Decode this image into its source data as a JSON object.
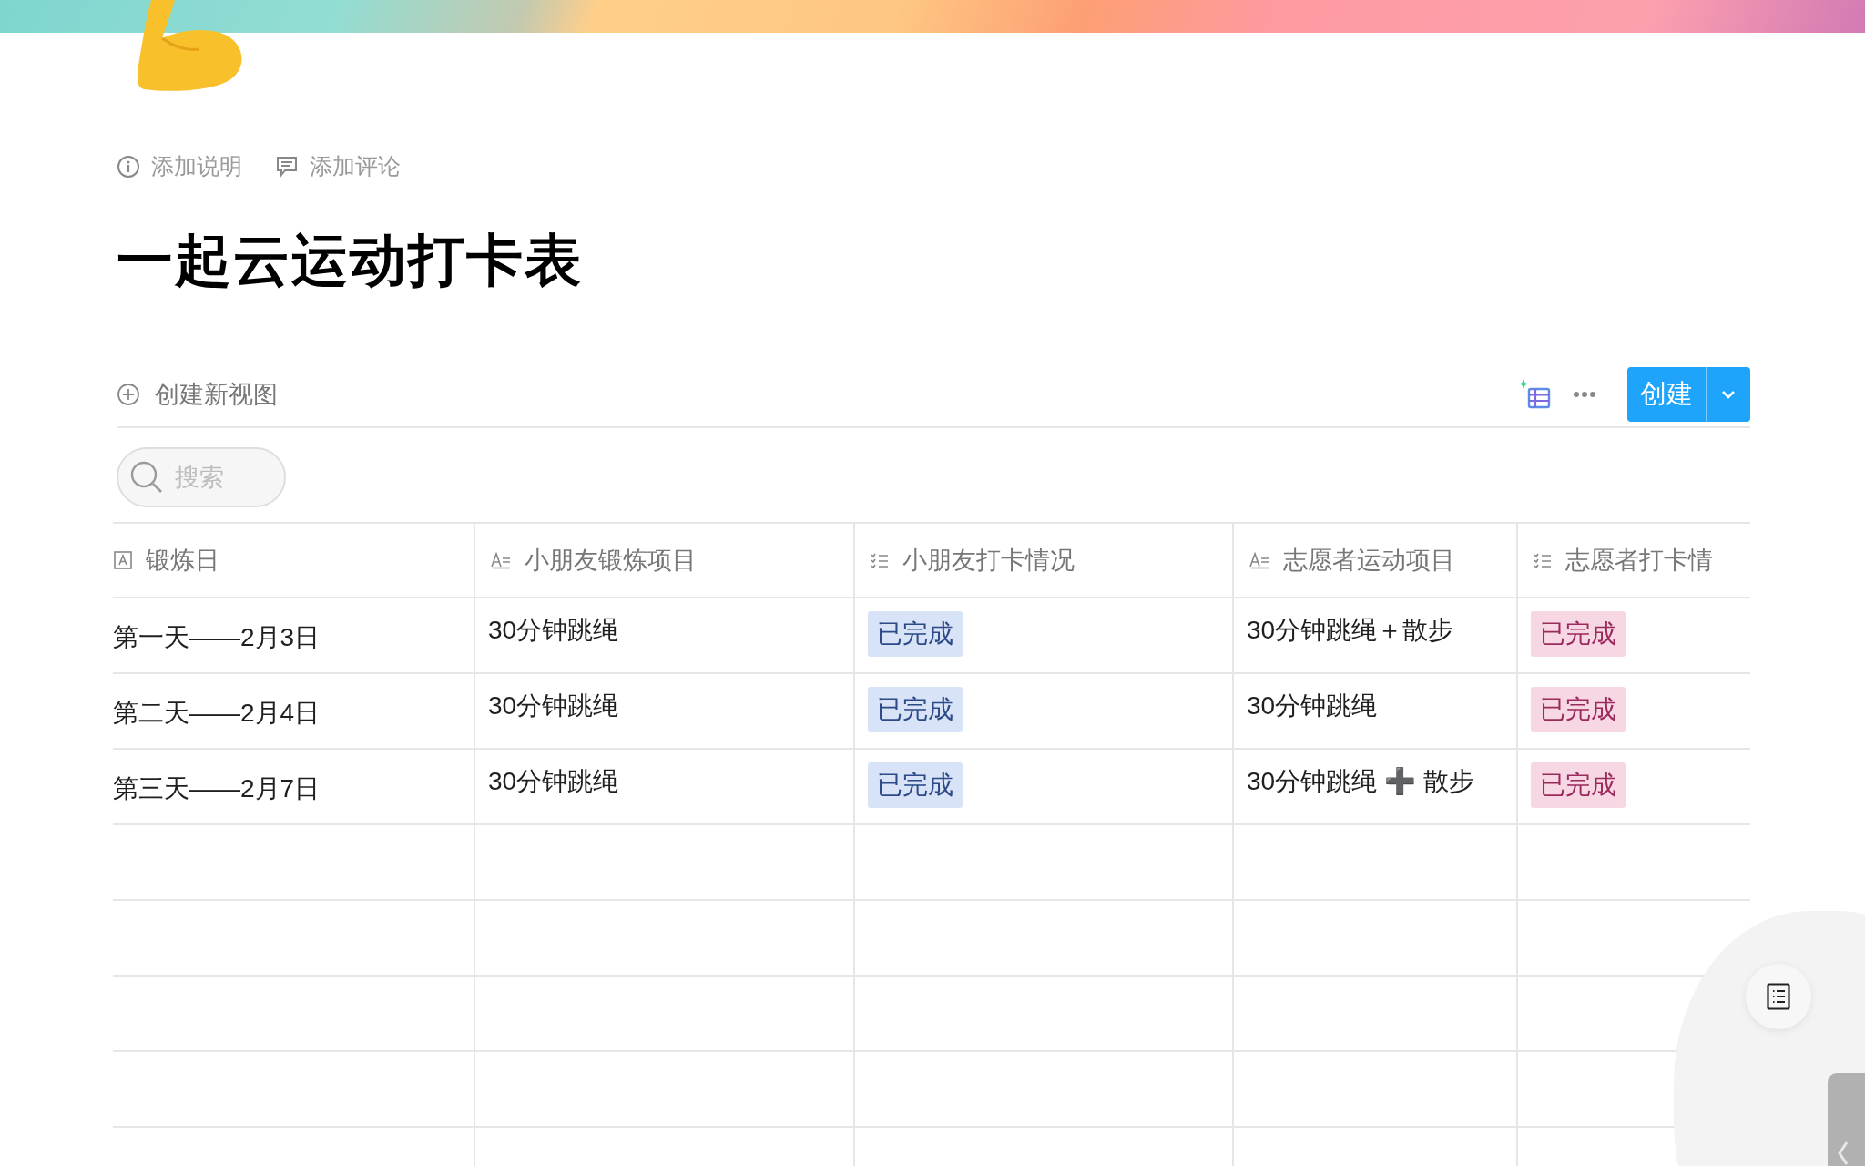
{
  "page": {
    "title": "一起云运动打卡表",
    "actions": [
      {
        "kind": "info",
        "label": "添加说明"
      },
      {
        "kind": "comment",
        "label": "添加评论"
      }
    ]
  },
  "toolbar": {
    "new_view": "创建新视图",
    "create_button": "创建"
  },
  "search": {
    "placeholder": "搜索"
  },
  "table": {
    "columns": [
      {
        "kind": "primary",
        "label": "锻炼日"
      },
      {
        "kind": "text",
        "label": "小朋友锻炼项目"
      },
      {
        "kind": "select",
        "label": "小朋友打卡情况"
      },
      {
        "kind": "text",
        "label": "志愿者运动项目"
      },
      {
        "kind": "select",
        "label": "志愿者打卡情"
      }
    ],
    "rows": [
      {
        "cells": [
          {
            "text": "第一天——2月3日"
          },
          {
            "text": "30分钟跳绳"
          },
          {
            "tag": "已完成",
            "color": "#d8e3f8"
          },
          {
            "text": "30分钟跳绳＋散步"
          },
          {
            "tag": "已完成",
            "color": "#f8d7e5"
          }
        ]
      },
      {
        "cells": [
          {
            "text": "第二天——2月4日"
          },
          {
            "text": "30分钟跳绳"
          },
          {
            "tag": "已完成",
            "color": "#d8e3f8"
          },
          {
            "text": "30分钟跳绳"
          },
          {
            "tag": "已完成",
            "color": "#f8d7e5"
          }
        ]
      },
      {
        "cells": [
          {
            "text": "第三天——2月7日"
          },
          {
            "text": "30分钟跳绳"
          },
          {
            "tag": "已完成",
            "color": "#d8e3f8"
          },
          {
            "text": "30分钟跳绳 ➕ 散步"
          },
          {
            "tag": "已完成",
            "color": "#f8d7e5"
          }
        ]
      }
    ]
  }
}
